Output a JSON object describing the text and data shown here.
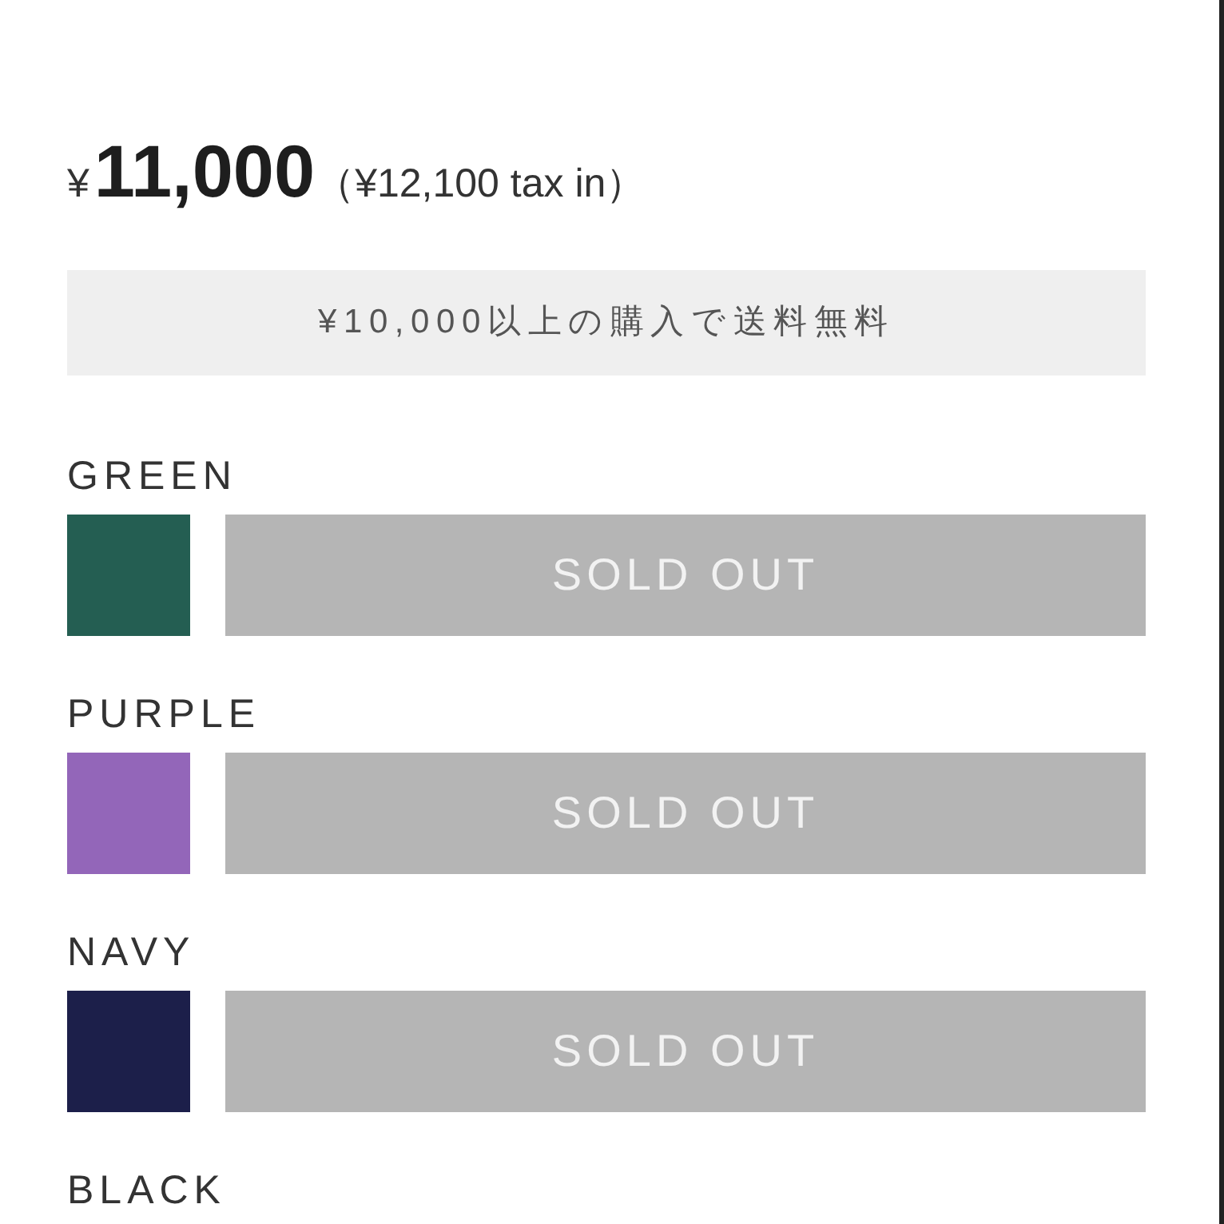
{
  "price": {
    "currency": "¥",
    "amount": "11,000",
    "tax_note": "（¥12,100 tax in）"
  },
  "shipping_banner": {
    "text": "¥10,000以上の購入で送料無料"
  },
  "variants": [
    {
      "name": "GREEN",
      "color": "#245e52",
      "button": "SOLD OUT",
      "sold_out": true
    },
    {
      "name": "PURPLE",
      "color": "#9366b9",
      "button": "SOLD OUT",
      "sold_out": true
    },
    {
      "name": "NAVY",
      "color": "#1c1f4a",
      "button": "SOLD OUT",
      "sold_out": true
    },
    {
      "name": "BLACK"
    }
  ]
}
